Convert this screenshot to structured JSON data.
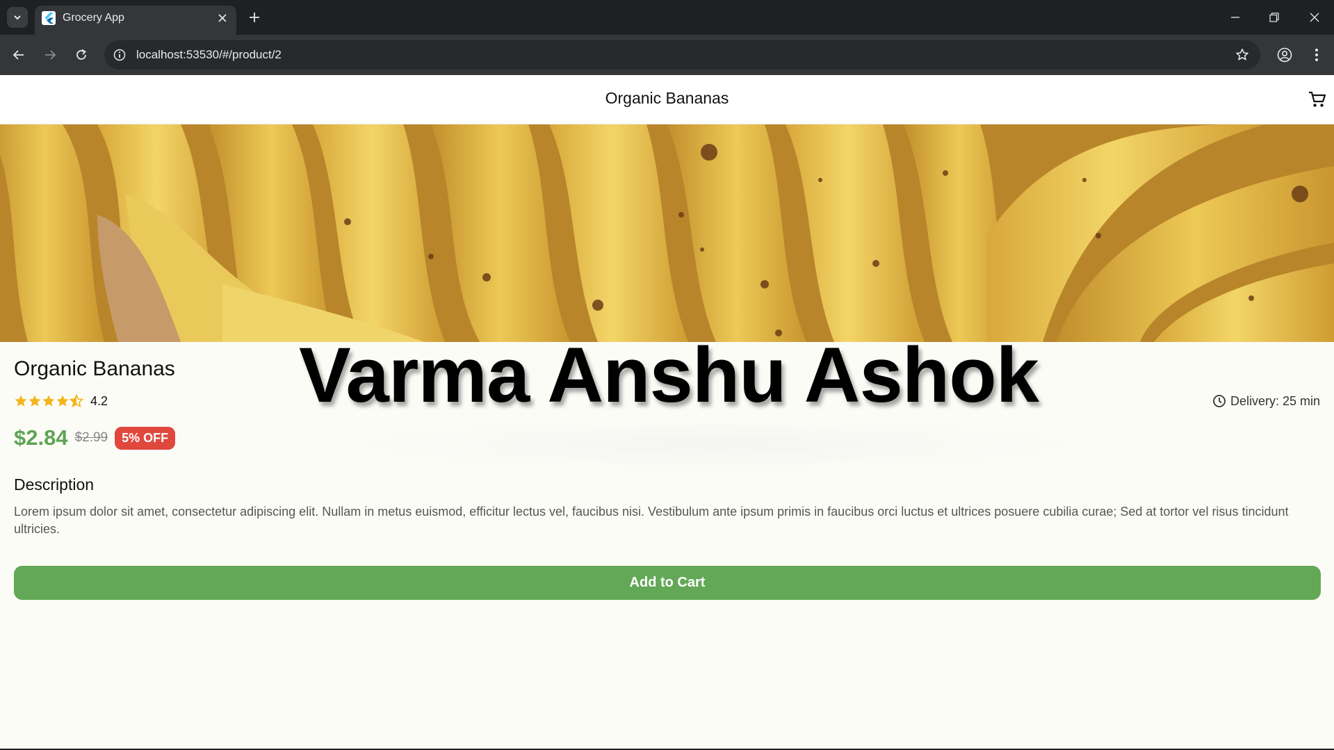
{
  "browser": {
    "tab_title": "Grocery App",
    "url": "localhost:53530/#/product/2"
  },
  "appbar": {
    "title": "Organic Bananas"
  },
  "product": {
    "name": "Organic Bananas",
    "rating": "4.2",
    "rating_stars": 4.2,
    "delivery": "Delivery: 25 min",
    "price": "$2.84",
    "old_price": "$2.99",
    "discount": "5% OFF",
    "description_title": "Description",
    "description": "Lorem ipsum dolor sit amet, consectetur adipiscing elit. Nullam in metus euismod, efficitur lectus vel, faucibus nisi. Vestibulum ante ipsum primis in faucibus orci luctus et ultrices posuere cubilia curae; Sed at tortor vel risus tincidunt ultricies.",
    "add_to_cart": "Add to Cart"
  },
  "overlay": {
    "watermark": "Varma Anshu Ashok"
  },
  "colors": {
    "price": "#5ea453",
    "discount_badge": "#e0483e",
    "add_button": "#63a856",
    "star": "#f2b51b"
  }
}
